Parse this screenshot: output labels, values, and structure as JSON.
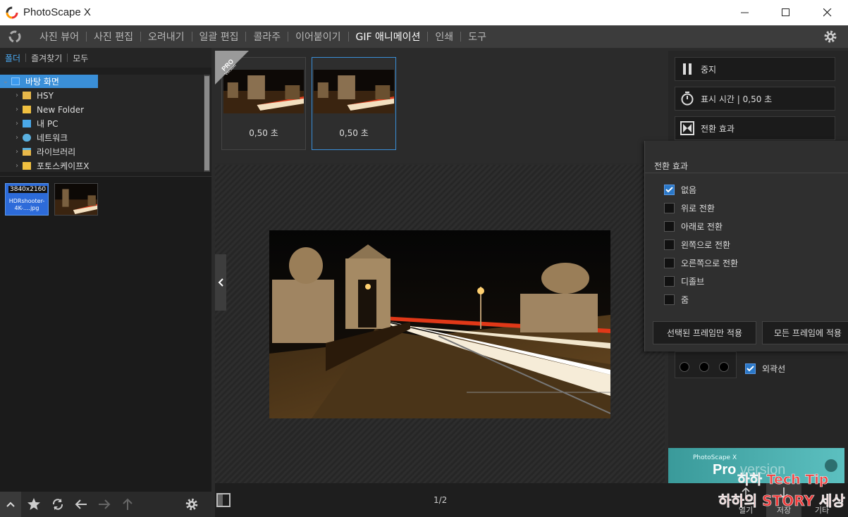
{
  "window": {
    "title": "PhotoScape X"
  },
  "menu": {
    "items": [
      "사진 뷰어",
      "사진 편집",
      "오려내기",
      "일괄 편집",
      "콜라주",
      "이어붙이기",
      "GIF 애니메이션",
      "인쇄",
      "도구"
    ],
    "active": "GIF 애니메이션"
  },
  "left_panel": {
    "tabs": [
      "폴더",
      "즐겨찾기",
      "모두"
    ],
    "tree": [
      {
        "label": "바탕 화면",
        "selected": true
      },
      {
        "label": "HSY"
      },
      {
        "label": "New Folder"
      },
      {
        "label": "내 PC"
      },
      {
        "label": "네트워크"
      },
      {
        "label": "라이브러리"
      },
      {
        "label": "포토스케이프X"
      }
    ],
    "thumbnail": {
      "resolution": "3840x2160",
      "filename": "HDRshooter-4K-....jpg"
    }
  },
  "frames": [
    {
      "duration": "0,50 초",
      "selected": false
    },
    {
      "duration": "0,50 초",
      "selected": true
    }
  ],
  "pro_badge": {
    "line1": "PRO",
    "line2": "Version"
  },
  "pager": "1/2",
  "right_panel": {
    "stop_label": "중지",
    "display_time_label": "표시 시간 | 0,50 초",
    "transition_label": "전환 효과",
    "outline_label": "외곽선",
    "outline_checked": true,
    "promo": {
      "small": "PhotoScape X",
      "big": "Pro",
      "big_faded": " version"
    }
  },
  "popup": {
    "title": "전환 효과",
    "options": [
      {
        "label": "없음",
        "checked": true
      },
      {
        "label": "위로 전환",
        "checked": false
      },
      {
        "label": "아래로 전환",
        "checked": false
      },
      {
        "label": "왼쪽으로 전환",
        "checked": false
      },
      {
        "label": "오른쪽으로 전환",
        "checked": false
      },
      {
        "label": "디졸브",
        "checked": false
      },
      {
        "label": "줌",
        "checked": false
      }
    ],
    "apply_selected": "선택된 프레임만 적용",
    "apply_all": "모든 프레임에 적용"
  },
  "bottom_right": {
    "open": "열기",
    "save": "저장",
    "other": "기타"
  },
  "watermark": {
    "line1": "하하 Tech Tip",
    "line2": "하하의 STORY 세상"
  },
  "colors": {
    "accent": "#3a8fd8",
    "popup_bg": "#2f2f2f",
    "watermark": "#ff3b3b"
  }
}
